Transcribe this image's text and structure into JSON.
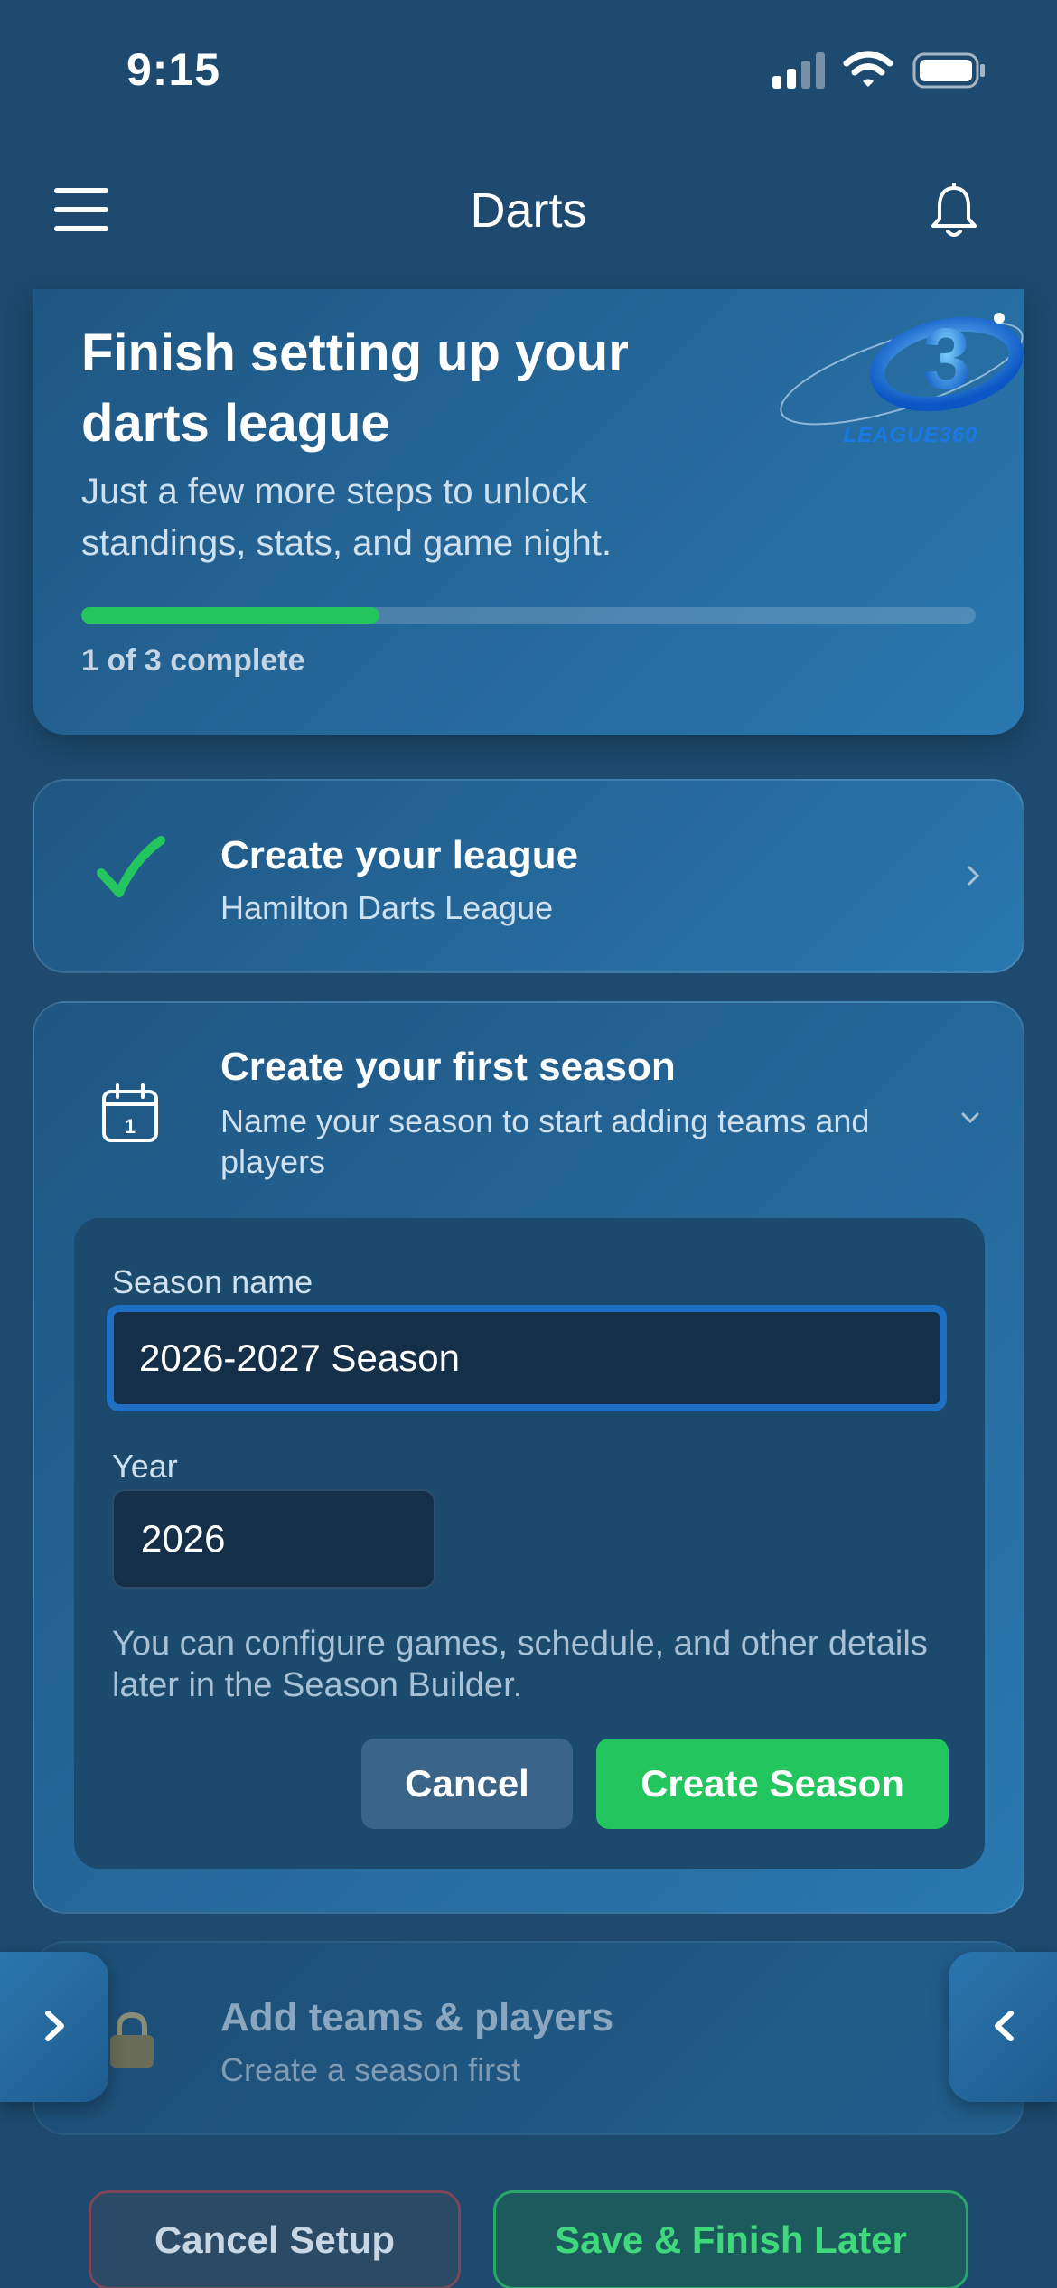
{
  "status_bar": {
    "time": "9:15"
  },
  "nav": {
    "title": "Darts"
  },
  "hero": {
    "title": "Finish setting up your darts league",
    "subtitle": "Just a few more steps to unlock standings, stats, and game night.",
    "logo_text": "LEAGUE360",
    "progress": {
      "completed": 1,
      "total": 3,
      "fraction": 0.333,
      "label": "1 of 3 complete"
    }
  },
  "steps": [
    {
      "title": "Create your league",
      "subtitle": "Hamilton Darts League",
      "status": "complete"
    },
    {
      "title": "Create your first season",
      "subtitle": "Name your season to start adding teams and players",
      "status": "active",
      "form": {
        "season_label": "Season name",
        "season_value": "2026-2027 Season",
        "year_label": "Year",
        "year_value": "2026",
        "help": "You can configure games, schedule, and other details later in the Season Builder.",
        "cancel_label": "Cancel",
        "create_label": "Create Season"
      }
    },
    {
      "title": "Add teams & players",
      "subtitle": "Create a season first",
      "status": "locked"
    }
  ],
  "footer": {
    "cancel_setup_label": "Cancel Setup",
    "save_later_label": "Save & Finish Later"
  },
  "colors": {
    "background": "#1d4a6e",
    "accent_green": "#22c55e",
    "focus_blue": "#1f6fc4"
  },
  "icons": [
    "menu-icon",
    "bell-icon",
    "checkmark-icon",
    "calendar-icon",
    "lock-icon",
    "chevron-right-icon",
    "chevron-down-icon"
  ]
}
